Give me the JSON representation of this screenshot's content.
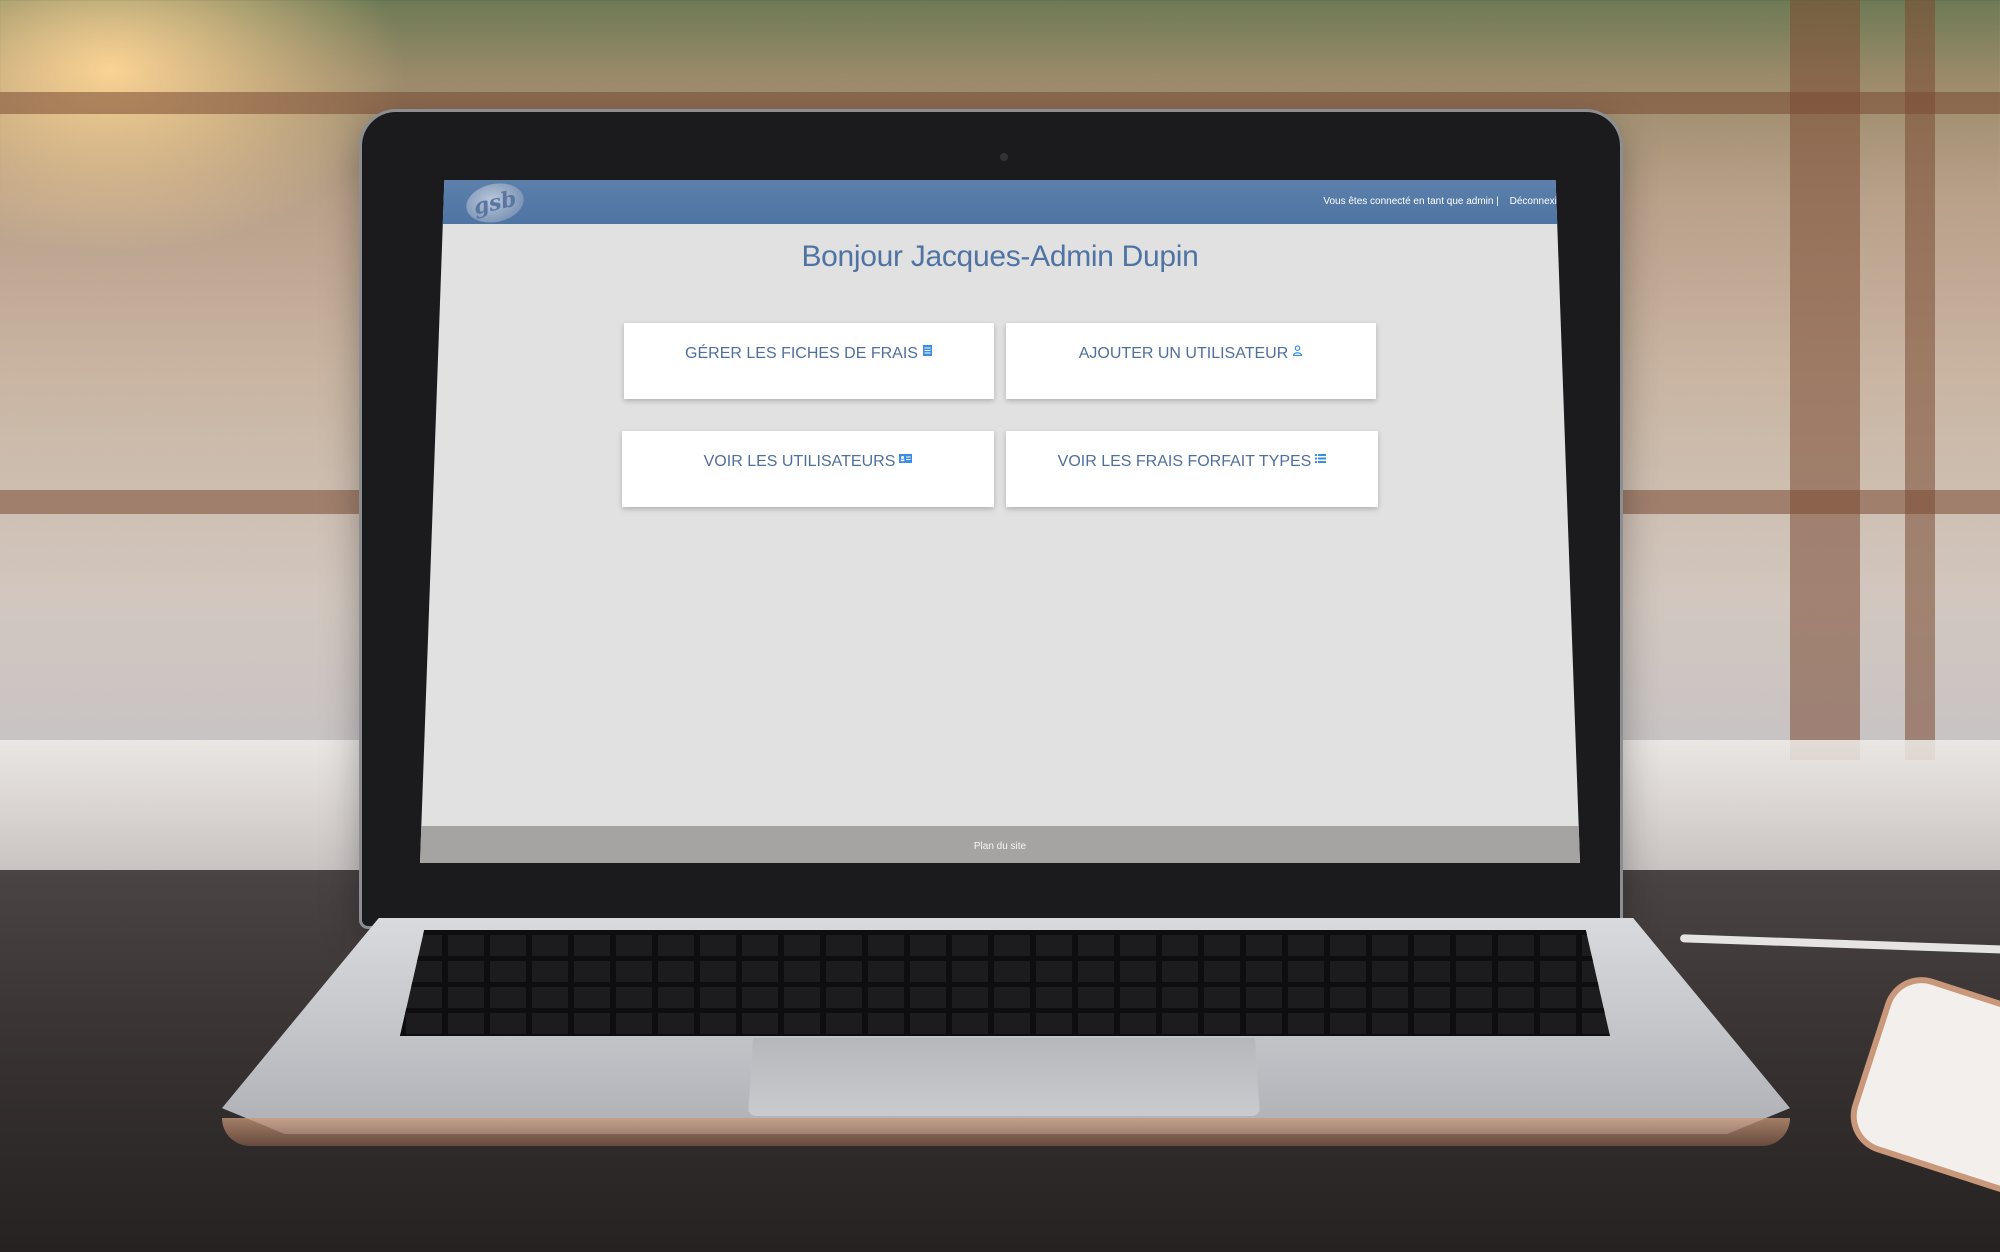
{
  "app": {
    "logo_text": "gsb",
    "session_text": "Vous êtes connecté en tant que admin |",
    "logout_label": "Déconnexion"
  },
  "main": {
    "title": "Bonjour Jacques-Admin Dupin",
    "cards": [
      {
        "label": "GÉRER LES FICHES DE FRAIS",
        "icon": "document-icon"
      },
      {
        "label": "AJOUTER UN UTILISATEUR",
        "icon": "user-add-icon"
      },
      {
        "label": "VOIR LES UTILISATEURS",
        "icon": "id-card-icon"
      },
      {
        "label": "VOIR LES FRAIS FORFAIT TYPES",
        "icon": "list-icon"
      }
    ]
  },
  "footer": {
    "site_map_label": "Plan du site"
  },
  "colors": {
    "header": "#4e74a3",
    "accent_text": "#4f74a4",
    "icon_blue": "#3a8fe0",
    "footer": "#a6a3a3"
  }
}
